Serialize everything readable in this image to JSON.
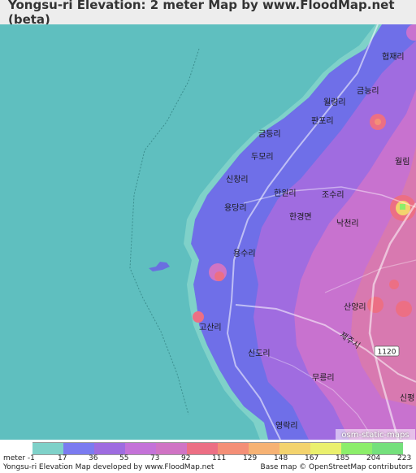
{
  "title": "Yongsu-ri Elevation: 2 meter Map by www.FloodMap.net (beta)",
  "map": {
    "places": [
      {
        "id": "hyeopjae",
        "label": "협재리"
      },
      {
        "id": "geumneung",
        "label": "금능리"
      },
      {
        "id": "wollyeong",
        "label": "월령리"
      },
      {
        "id": "panpo",
        "label": "판포리"
      },
      {
        "id": "geumdeung",
        "label": "금등리"
      },
      {
        "id": "dumo",
        "label": "두모리"
      },
      {
        "id": "wollim",
        "label": "월림"
      },
      {
        "id": "sinchang",
        "label": "신창리"
      },
      {
        "id": "hanwon",
        "label": "한원리"
      },
      {
        "id": "josu",
        "label": "조수리"
      },
      {
        "id": "yongdang",
        "label": "용당리"
      },
      {
        "id": "hangyeong",
        "label": "한경면"
      },
      {
        "id": "nakcheon",
        "label": "낙천리"
      },
      {
        "id": "yongsu",
        "label": "용수리"
      },
      {
        "id": "sanyang",
        "label": "산양리"
      },
      {
        "id": "gosan",
        "label": "고산리"
      },
      {
        "id": "jeju-sign",
        "label": "제주시"
      },
      {
        "id": "road-1120",
        "label": "1120"
      },
      {
        "id": "sindo",
        "label": "신도리"
      },
      {
        "id": "mureung",
        "label": "무릉리"
      },
      {
        "id": "sinpyeong",
        "label": "신평"
      },
      {
        "id": "yeongnak",
        "label": "영락리"
      }
    ],
    "attribution": "osm-static-maps"
  },
  "legend": {
    "colors": [
      "#7fd1c9",
      "#7b7bf0",
      "#9e6ce0",
      "#c472d8",
      "#d074c4",
      "#ec6f84",
      "#f48f77",
      "#f6b274",
      "#f3d36d",
      "#eaf06d",
      "#8cee6a",
      "#74e07c"
    ],
    "labels": [
      "meter -1",
      "17",
      "36",
      "55",
      "73",
      "92",
      "111",
      "129",
      "148",
      "167",
      "185",
      "204",
      "223"
    ]
  },
  "footer": {
    "left": "Yongsu-ri Elevation Map developed by www.FloodMap.net",
    "right": "Base map © OpenStreetMap contributors"
  }
}
